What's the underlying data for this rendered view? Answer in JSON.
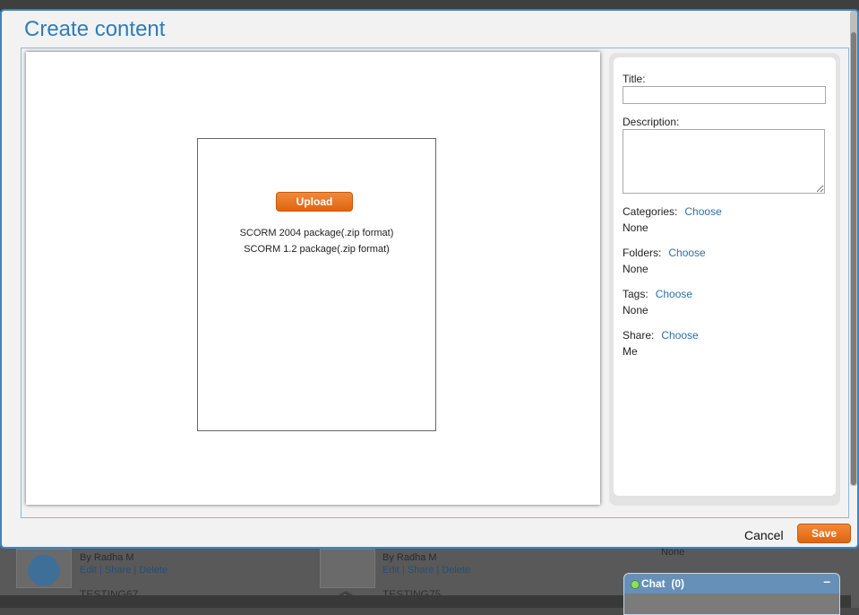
{
  "modal": {
    "title": "Create content",
    "upload_label": "Upload",
    "formats": [
      "SCORM 2004 package(.zip format)",
      "SCORM 1.2 package(.zip format)"
    ],
    "cancel_label": "Cancel",
    "save_label": "Save"
  },
  "form": {
    "title_label": "Title:",
    "title_value": "",
    "description_label": "Description:",
    "description_value": "",
    "categories": {
      "label": "Categories:",
      "action": "Choose",
      "value": "None"
    },
    "folders": {
      "label": "Folders:",
      "action": "Choose",
      "value": "None"
    },
    "tags": {
      "label": "Tags:",
      "action": "Choose",
      "value": "None"
    },
    "share": {
      "label": "Share:",
      "action": "Choose",
      "value": "Me"
    }
  },
  "background": {
    "items": [
      {
        "author": "By Radha M",
        "edit": "Edit",
        "share": "Share",
        "delete": "Delete",
        "next_title": "TESTING67"
      },
      {
        "author": "By Radha M",
        "edit": "Edit",
        "share": "Share",
        "delete": "Delete",
        "next_title": "TESTING75"
      }
    ],
    "side_value": "None"
  },
  "chat": {
    "label": "Chat",
    "count": "(0)",
    "minimize": "–"
  },
  "colors": {
    "accent": "#2d7dbb",
    "button": "#e8731f",
    "chat_header": "#6790b8"
  },
  "icons": [
    "globe-icon",
    "graduation-cap-icon",
    "status-online-icon",
    "minimize-icon"
  ]
}
